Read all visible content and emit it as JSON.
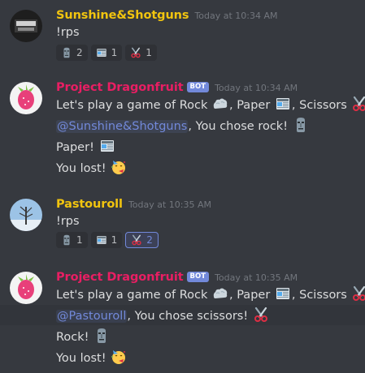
{
  "messages": [
    {
      "username": "Sunshine&Shotguns",
      "username_color": "#f1c40f",
      "timestamp": "Today at 10:34 AM",
      "lines": {
        "l1": "!rps"
      },
      "reactions": [
        {
          "icon": "moai-icon",
          "count": "2"
        },
        {
          "icon": "newspaper-icon",
          "count": "1"
        },
        {
          "icon": "scissors-icon",
          "count": "1"
        }
      ]
    },
    {
      "username": "Project Dragonfruit",
      "username_color": "#e91e63",
      "bot_tag": "BOT",
      "timestamp": "Today at 10:34 AM",
      "lines": {
        "l1_a": "Let's play a game of Rock ",
        "l1_b": ", Paper ",
        "l1_c": ", Scissors ",
        "l1_d": "!",
        "l2_mention": "@Sunshine&Shotguns",
        "l2_text": ", You chose rock! ",
        "l3": "Paper! ",
        "l4": "You lost! "
      }
    },
    {
      "username": "Pastouroll",
      "username_color": "#f1c40f",
      "timestamp": "Today at 10:35 AM",
      "lines": {
        "l1": "!rps"
      },
      "reactions": [
        {
          "icon": "moai-icon",
          "count": "1"
        },
        {
          "icon": "newspaper-icon",
          "count": "1"
        },
        {
          "icon": "scissors-icon",
          "count": "2"
        }
      ]
    },
    {
      "username": "Project Dragonfruit",
      "username_color": "#e91e63",
      "bot_tag": "BOT",
      "timestamp": "Today at 10:35 AM",
      "lines": {
        "l1_a": "Let's play a game of Rock ",
        "l1_b": ", Paper ",
        "l1_c": ", Scissors ",
        "l1_d": "!",
        "l2_mention": "@Pastouroll",
        "l2_text": ", You chose scissors! ",
        "l3": "Rock! ",
        "l4": "You lost! "
      }
    }
  ],
  "colors": {
    "background": "#36393f",
    "mention": "#7289da",
    "bot_tag": "#7289da"
  }
}
